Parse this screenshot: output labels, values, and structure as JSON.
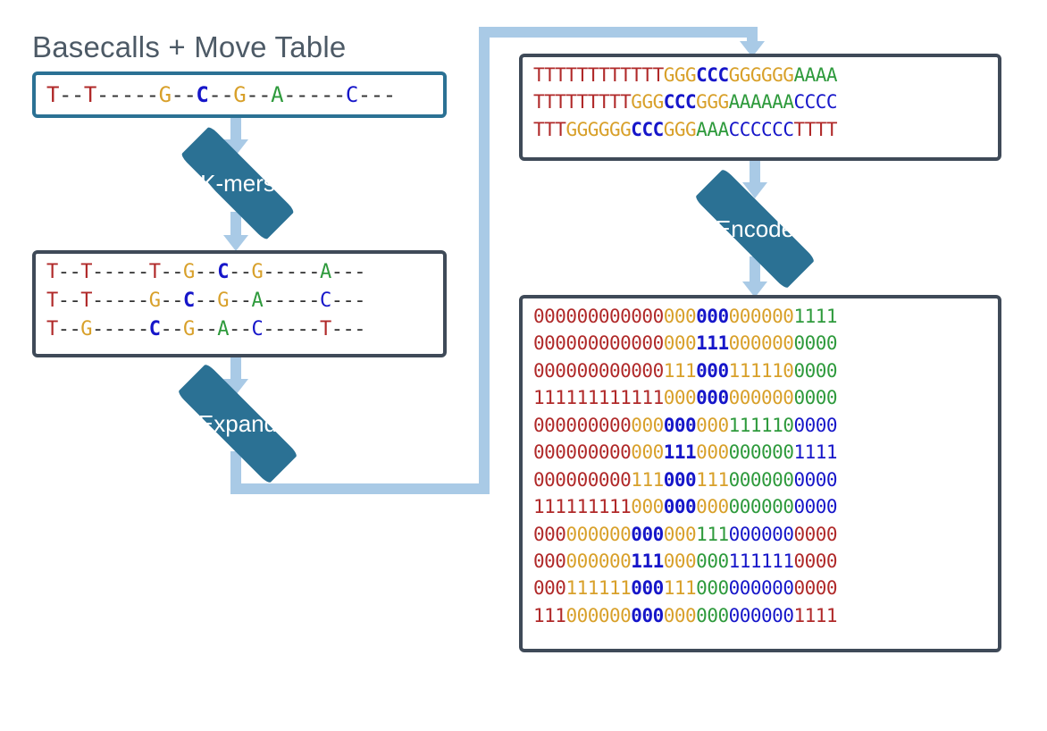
{
  "title": "Basecalls + Move Table",
  "steps": {
    "kmers": "K-mers",
    "expand": "Expand",
    "encode": "Encode"
  },
  "colors": {
    "T": "#b02929",
    "G": "#d8a02a",
    "A": "#2e9a3c",
    "C": "#1616c9",
    "dash": "#333333",
    "diamond": "#2b7194",
    "arrow": "#a9cae6",
    "border": "#3f4a58"
  },
  "box1": {
    "rows": [
      [
        [
          "T",
          "T"
        ],
        [
          "-",
          "--"
        ],
        [
          "T",
          "T"
        ],
        [
          "-",
          "-----"
        ],
        [
          "G",
          "G"
        ],
        [
          "-",
          "--"
        ],
        [
          "C*",
          "C"
        ],
        [
          "-",
          "--"
        ],
        [
          "G",
          "G"
        ],
        [
          "-",
          "--"
        ],
        [
          "A",
          "A"
        ],
        [
          "-",
          "-----"
        ],
        [
          "C",
          "C"
        ],
        [
          "-",
          "---"
        ]
      ]
    ]
  },
  "box2": {
    "rows": [
      [
        [
          "T",
          "T"
        ],
        [
          "-",
          "--"
        ],
        [
          "T",
          "T"
        ],
        [
          "-",
          "-----"
        ],
        [
          "T",
          "T"
        ],
        [
          "-",
          "--"
        ],
        [
          "G",
          "G"
        ],
        [
          "-",
          "--"
        ],
        [
          "C*",
          "C"
        ],
        [
          "-",
          "--"
        ],
        [
          "G",
          "G"
        ],
        [
          "-",
          "-----"
        ],
        [
          "A",
          "A"
        ],
        [
          "-",
          "---"
        ]
      ],
      [
        [
          "T",
          "T"
        ],
        [
          "-",
          "--"
        ],
        [
          "T",
          "T"
        ],
        [
          "-",
          "-----"
        ],
        [
          "G",
          "G"
        ],
        [
          "-",
          "--"
        ],
        [
          "C*",
          "C"
        ],
        [
          "-",
          "--"
        ],
        [
          "G",
          "G"
        ],
        [
          "-",
          "--"
        ],
        [
          "A",
          "A"
        ],
        [
          "-",
          "-----"
        ],
        [
          "C",
          "C"
        ],
        [
          "-",
          "---"
        ]
      ],
      [
        [
          "T",
          "T"
        ],
        [
          "-",
          "--"
        ],
        [
          "G",
          "G"
        ],
        [
          "-",
          "-----"
        ],
        [
          "C*",
          "C"
        ],
        [
          "-",
          "--"
        ],
        [
          "G",
          "G"
        ],
        [
          "-",
          "--"
        ],
        [
          "A",
          "A"
        ],
        [
          "-",
          "--"
        ],
        [
          "C",
          "C"
        ],
        [
          "-",
          "-----"
        ],
        [
          "T",
          "T"
        ],
        [
          "-",
          "---"
        ]
      ]
    ]
  },
  "box3": {
    "rows": [
      [
        [
          "T",
          "TTTTTTTTTTTT"
        ],
        [
          "G",
          "GGG"
        ],
        [
          "C*",
          "CCC"
        ],
        [
          "G",
          "GGGGGG"
        ],
        [
          "A",
          "AAAA"
        ]
      ],
      [
        [
          "T",
          "TTTTTTTTT"
        ],
        [
          "G",
          "GGG"
        ],
        [
          "C*",
          "CCC"
        ],
        [
          "G",
          "GGG"
        ],
        [
          "A",
          "AAAAAA"
        ],
        [
          "C",
          "CCCC"
        ]
      ],
      [
        [
          "T",
          "TTT"
        ],
        [
          "G",
          "GGGGGG"
        ],
        [
          "C*",
          "CCC"
        ],
        [
          "G",
          "GGG"
        ],
        [
          "A",
          "AAA"
        ],
        [
          "C",
          "CCCCCC"
        ],
        [
          "T",
          "TTTT"
        ]
      ]
    ]
  },
  "box4": {
    "rows": [
      [
        [
          "T",
          "000000000000"
        ],
        [
          "G",
          "000"
        ],
        [
          "C*",
          "000"
        ],
        [
          "G",
          "000000"
        ],
        [
          "A",
          "1111"
        ]
      ],
      [
        [
          "T",
          "000000000000"
        ],
        [
          "G",
          "000"
        ],
        [
          "C*",
          "111"
        ],
        [
          "G",
          "000000"
        ],
        [
          "A",
          "0000"
        ]
      ],
      [
        [
          "T",
          "000000000000"
        ],
        [
          "G",
          "111"
        ],
        [
          "C*",
          "000"
        ],
        [
          "G",
          "111110"
        ],
        [
          "A",
          "0000"
        ]
      ],
      [
        [
          "T",
          "111111111111"
        ],
        [
          "G",
          "000"
        ],
        [
          "C*",
          "000"
        ],
        [
          "G",
          "000000"
        ],
        [
          "A",
          "0000"
        ]
      ],
      [
        [
          "T",
          "000000000"
        ],
        [
          "G",
          "000"
        ],
        [
          "C*",
          "000"
        ],
        [
          "G",
          "000"
        ],
        [
          "A",
          "111110"
        ],
        [
          "C",
          "0000"
        ]
      ],
      [
        [
          "T",
          "000000000"
        ],
        [
          "G",
          "000"
        ],
        [
          "C*",
          "111"
        ],
        [
          "G",
          "000"
        ],
        [
          "A",
          "000000"
        ],
        [
          "C",
          "1111"
        ]
      ],
      [
        [
          "T",
          "000000000"
        ],
        [
          "G",
          "111"
        ],
        [
          "C*",
          "000"
        ],
        [
          "G",
          "111"
        ],
        [
          "A",
          "000000"
        ],
        [
          "C",
          "0000"
        ]
      ],
      [
        [
          "T",
          "111111111"
        ],
        [
          "G",
          "000"
        ],
        [
          "C*",
          "000"
        ],
        [
          "G",
          "000"
        ],
        [
          "A",
          "000000"
        ],
        [
          "C",
          "0000"
        ]
      ],
      [
        [
          "T",
          "000"
        ],
        [
          "G",
          "000000"
        ],
        [
          "C*",
          "000"
        ],
        [
          "G",
          "000"
        ],
        [
          "A",
          "111"
        ],
        [
          "C",
          "000000"
        ],
        [
          "T",
          "0000"
        ]
      ],
      [
        [
          "T",
          "000"
        ],
        [
          "G",
          "000000"
        ],
        [
          "C*",
          "111"
        ],
        [
          "G",
          "000"
        ],
        [
          "A",
          "000"
        ],
        [
          "C",
          "111111"
        ],
        [
          "T",
          "0000"
        ]
      ],
      [
        [
          "T",
          "000"
        ],
        [
          "G",
          "111111"
        ],
        [
          "C*",
          "000"
        ],
        [
          "G",
          "111"
        ],
        [
          "A",
          "000"
        ],
        [
          "C",
          "000000"
        ],
        [
          "T",
          "0000"
        ]
      ],
      [
        [
          "T",
          "111"
        ],
        [
          "G",
          "000000"
        ],
        [
          "C*",
          "000"
        ],
        [
          "G",
          "000"
        ],
        [
          "A",
          "000"
        ],
        [
          "C",
          "000000"
        ],
        [
          "T",
          "1111"
        ]
      ]
    ]
  }
}
